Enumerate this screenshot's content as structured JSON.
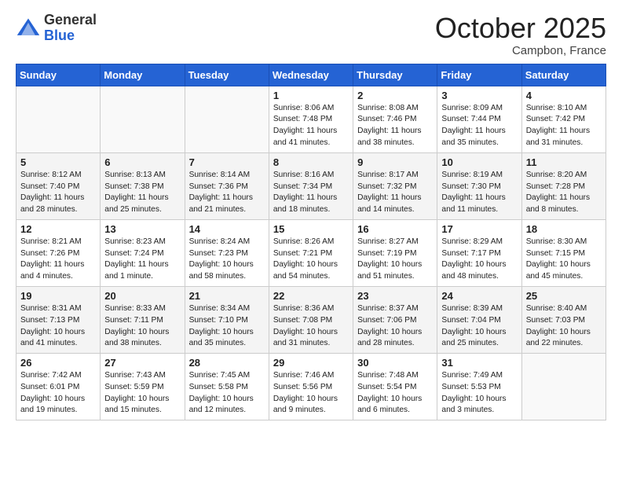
{
  "header": {
    "logo_general": "General",
    "logo_blue": "Blue",
    "month": "October 2025",
    "location": "Campbon, France"
  },
  "days_of_week": [
    "Sunday",
    "Monday",
    "Tuesday",
    "Wednesday",
    "Thursday",
    "Friday",
    "Saturday"
  ],
  "weeks": [
    [
      {
        "day": "",
        "info": ""
      },
      {
        "day": "",
        "info": ""
      },
      {
        "day": "",
        "info": ""
      },
      {
        "day": "1",
        "info": "Sunrise: 8:06 AM\nSunset: 7:48 PM\nDaylight: 11 hours\nand 41 minutes."
      },
      {
        "day": "2",
        "info": "Sunrise: 8:08 AM\nSunset: 7:46 PM\nDaylight: 11 hours\nand 38 minutes."
      },
      {
        "day": "3",
        "info": "Sunrise: 8:09 AM\nSunset: 7:44 PM\nDaylight: 11 hours\nand 35 minutes."
      },
      {
        "day": "4",
        "info": "Sunrise: 8:10 AM\nSunset: 7:42 PM\nDaylight: 11 hours\nand 31 minutes."
      }
    ],
    [
      {
        "day": "5",
        "info": "Sunrise: 8:12 AM\nSunset: 7:40 PM\nDaylight: 11 hours\nand 28 minutes."
      },
      {
        "day": "6",
        "info": "Sunrise: 8:13 AM\nSunset: 7:38 PM\nDaylight: 11 hours\nand 25 minutes."
      },
      {
        "day": "7",
        "info": "Sunrise: 8:14 AM\nSunset: 7:36 PM\nDaylight: 11 hours\nand 21 minutes."
      },
      {
        "day": "8",
        "info": "Sunrise: 8:16 AM\nSunset: 7:34 PM\nDaylight: 11 hours\nand 18 minutes."
      },
      {
        "day": "9",
        "info": "Sunrise: 8:17 AM\nSunset: 7:32 PM\nDaylight: 11 hours\nand 14 minutes."
      },
      {
        "day": "10",
        "info": "Sunrise: 8:19 AM\nSunset: 7:30 PM\nDaylight: 11 hours\nand 11 minutes."
      },
      {
        "day": "11",
        "info": "Sunrise: 8:20 AM\nSunset: 7:28 PM\nDaylight: 11 hours\nand 8 minutes."
      }
    ],
    [
      {
        "day": "12",
        "info": "Sunrise: 8:21 AM\nSunset: 7:26 PM\nDaylight: 11 hours\nand 4 minutes."
      },
      {
        "day": "13",
        "info": "Sunrise: 8:23 AM\nSunset: 7:24 PM\nDaylight: 11 hours\nand 1 minute."
      },
      {
        "day": "14",
        "info": "Sunrise: 8:24 AM\nSunset: 7:23 PM\nDaylight: 10 hours\nand 58 minutes."
      },
      {
        "day": "15",
        "info": "Sunrise: 8:26 AM\nSunset: 7:21 PM\nDaylight: 10 hours\nand 54 minutes."
      },
      {
        "day": "16",
        "info": "Sunrise: 8:27 AM\nSunset: 7:19 PM\nDaylight: 10 hours\nand 51 minutes."
      },
      {
        "day": "17",
        "info": "Sunrise: 8:29 AM\nSunset: 7:17 PM\nDaylight: 10 hours\nand 48 minutes."
      },
      {
        "day": "18",
        "info": "Sunrise: 8:30 AM\nSunset: 7:15 PM\nDaylight: 10 hours\nand 45 minutes."
      }
    ],
    [
      {
        "day": "19",
        "info": "Sunrise: 8:31 AM\nSunset: 7:13 PM\nDaylight: 10 hours\nand 41 minutes."
      },
      {
        "day": "20",
        "info": "Sunrise: 8:33 AM\nSunset: 7:11 PM\nDaylight: 10 hours\nand 38 minutes."
      },
      {
        "day": "21",
        "info": "Sunrise: 8:34 AM\nSunset: 7:10 PM\nDaylight: 10 hours\nand 35 minutes."
      },
      {
        "day": "22",
        "info": "Sunrise: 8:36 AM\nSunset: 7:08 PM\nDaylight: 10 hours\nand 31 minutes."
      },
      {
        "day": "23",
        "info": "Sunrise: 8:37 AM\nSunset: 7:06 PM\nDaylight: 10 hours\nand 28 minutes."
      },
      {
        "day": "24",
        "info": "Sunrise: 8:39 AM\nSunset: 7:04 PM\nDaylight: 10 hours\nand 25 minutes."
      },
      {
        "day": "25",
        "info": "Sunrise: 8:40 AM\nSunset: 7:03 PM\nDaylight: 10 hours\nand 22 minutes."
      }
    ],
    [
      {
        "day": "26",
        "info": "Sunrise: 7:42 AM\nSunset: 6:01 PM\nDaylight: 10 hours\nand 19 minutes."
      },
      {
        "day": "27",
        "info": "Sunrise: 7:43 AM\nSunset: 5:59 PM\nDaylight: 10 hours\nand 15 minutes."
      },
      {
        "day": "28",
        "info": "Sunrise: 7:45 AM\nSunset: 5:58 PM\nDaylight: 10 hours\nand 12 minutes."
      },
      {
        "day": "29",
        "info": "Sunrise: 7:46 AM\nSunset: 5:56 PM\nDaylight: 10 hours\nand 9 minutes."
      },
      {
        "day": "30",
        "info": "Sunrise: 7:48 AM\nSunset: 5:54 PM\nDaylight: 10 hours\nand 6 minutes."
      },
      {
        "day": "31",
        "info": "Sunrise: 7:49 AM\nSunset: 5:53 PM\nDaylight: 10 hours\nand 3 minutes."
      },
      {
        "day": "",
        "info": ""
      }
    ]
  ]
}
